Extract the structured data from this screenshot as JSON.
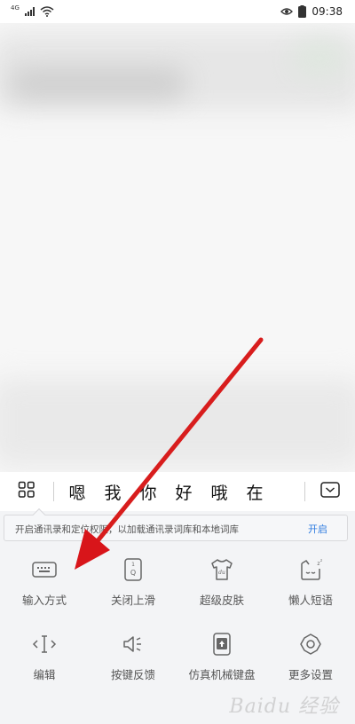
{
  "status_bar": {
    "network": "4G",
    "time": "09:38"
  },
  "candidate_bar": {
    "candidates": [
      "嗯",
      "我",
      "你",
      "好",
      "哦",
      "在"
    ]
  },
  "notice": {
    "text": "开启通讯录和定位权限，以加载通讯录词库和本地词库",
    "action": "开启"
  },
  "tools": [
    {
      "label": "输入方式",
      "icon": "keyboard-icon"
    },
    {
      "label": "关闭上滑",
      "icon": "swipe-key-icon"
    },
    {
      "label": "超级皮肤",
      "icon": "tshirt-icon"
    },
    {
      "label": "懒人短语",
      "icon": "lazy-phrase-icon"
    },
    {
      "label": "编辑",
      "icon": "text-cursor-icon"
    },
    {
      "label": "按键反馈",
      "icon": "speaker-icon"
    },
    {
      "label": "仿真机械键盘",
      "icon": "mechanical-keyboard-icon"
    },
    {
      "label": "更多设置",
      "icon": "gear-icon"
    }
  ],
  "watermark": "Baidu 经验",
  "colors": {
    "accent": "#2d7be0",
    "arrow": "#e0191c",
    "keyboard_bg": "#f3f4f6"
  }
}
